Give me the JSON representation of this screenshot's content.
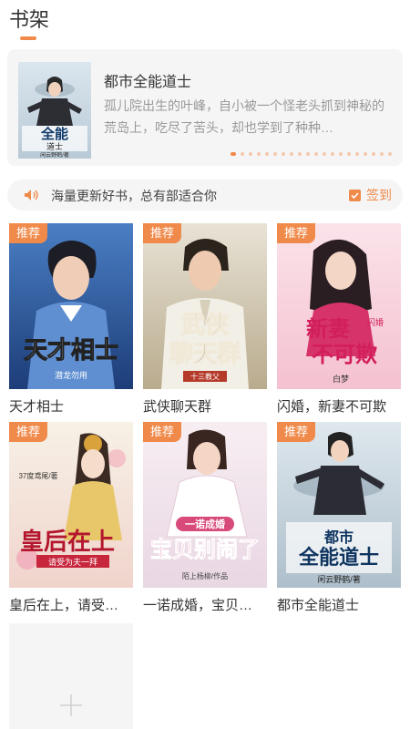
{
  "header": {
    "title": "书架"
  },
  "featured": {
    "title": "都市全能道士",
    "description": "孤儿院出生的叶峰，自小被一个怪老头抓到神秘的荒岛上，吃尽了苦头，却也学到了种种…",
    "cover_text": "都市全能道士",
    "cover_author": "闲云野鹤/著",
    "carousel_dots": 20,
    "carousel_active_index": 0
  },
  "notice": {
    "icon": "speaker-icon",
    "text": "海量更新好书，总有部适合你",
    "checkin_label": "签到",
    "checkin_icon": "check-square-icon"
  },
  "tag_label": "推荐",
  "books": [
    {
      "title": "天才相士",
      "cover_text": "天才相士",
      "cover_author": "潜龙勿用"
    },
    {
      "title": "武侠聊天群",
      "cover_text": "武侠聊天群",
      "cover_author": "十三教父"
    },
    {
      "title": "闪婚，新妻不可欺",
      "cover_text": "新妻不可欺",
      "cover_author": "白梦"
    },
    {
      "title": "皇后在上，请受…",
      "cover_text": "皇后在上",
      "cover_author": "37度鸢尾/著"
    },
    {
      "title": "一诺成婚，宝贝…",
      "cover_text": "宝贝别闹了",
      "cover_author": "陌上杨柳/作品"
    },
    {
      "title": "都市全能道士",
      "cover_text": "都市全能道士",
      "cover_author": "闲云野鹤/著"
    }
  ],
  "add_book": {
    "icon": "plus-icon"
  },
  "colors": {
    "accent": "#f08a4b",
    "card_bg": "#f5f5f5",
    "text_secondary": "#999999"
  }
}
